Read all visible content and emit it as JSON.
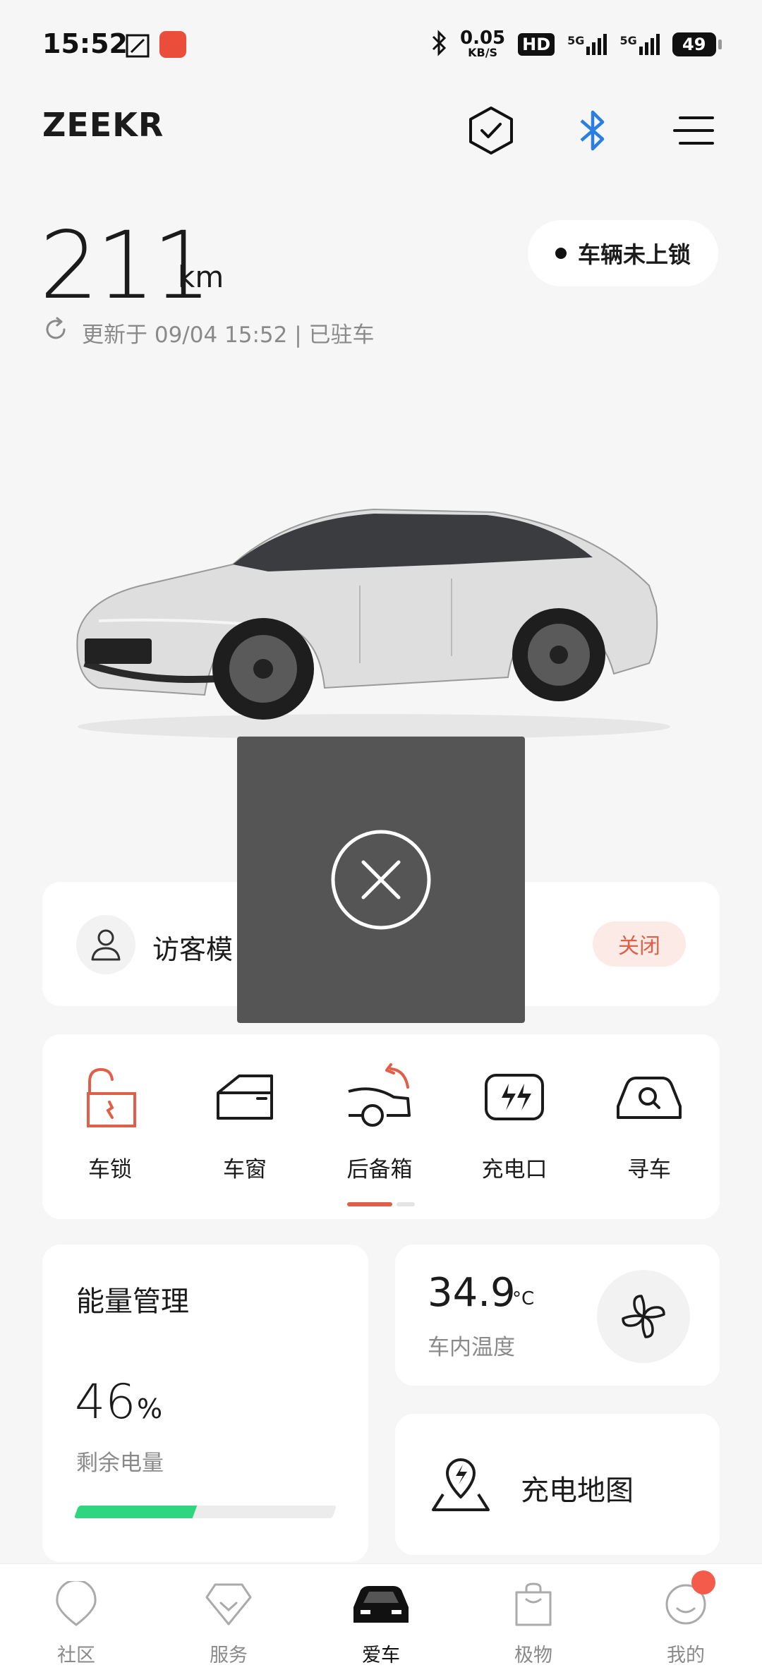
{
  "status_bar": {
    "time": "15:52",
    "net_speed_value": "0.05",
    "net_speed_unit": "KB/S",
    "hd_label": "HD",
    "network_1": "5G",
    "network_2": "5G",
    "battery": "49"
  },
  "header": {
    "brand": "ZEEKR"
  },
  "vehicle": {
    "range_value": "211",
    "range_unit": "km",
    "lock_status": "车辆未上锁",
    "update_text": "更新于 09/04 15:52 | 已驻车"
  },
  "guest_mode": {
    "label": "访客模",
    "button": "关闭"
  },
  "controls": [
    {
      "label": "车锁",
      "icon": "unlock-icon",
      "active": true
    },
    {
      "label": "车窗",
      "icon": "window-icon",
      "active": false
    },
    {
      "label": "后备箱",
      "icon": "trunk-icon",
      "active": false
    },
    {
      "label": "充电口",
      "icon": "charge-port-icon",
      "active": false
    },
    {
      "label": "寻车",
      "icon": "find-car-icon",
      "active": false
    }
  ],
  "energy": {
    "title": "能量管理",
    "percent_value": "46",
    "percent_unit": "%",
    "subtitle": "剩余电量",
    "level": 0.46
  },
  "climate": {
    "temp_value": "34.9",
    "temp_unit": "°C",
    "subtitle": "车内温度"
  },
  "charging_map": {
    "label": "充电地图"
  },
  "bottom_nav": [
    {
      "label": "社区",
      "active": false
    },
    {
      "label": "服务",
      "active": false
    },
    {
      "label": "爱车",
      "active": true
    },
    {
      "label": "极物",
      "active": false
    },
    {
      "label": "我的",
      "active": false
    }
  ],
  "colors": {
    "accent": "#e05f48",
    "battery_fill": "#2fd67f",
    "bluetooth": "#2a7de1"
  }
}
